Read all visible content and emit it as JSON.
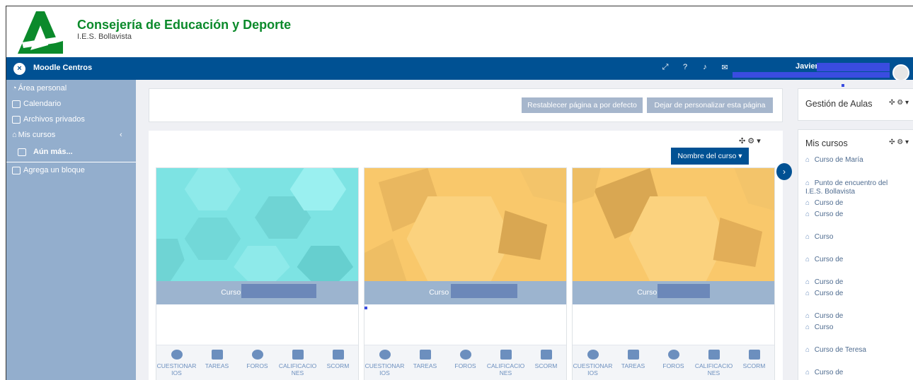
{
  "header": {
    "title": "Consejería de Educación y Deporte",
    "subtitle": "I.E.S. Bollavista"
  },
  "navbar": {
    "site_name": "Moodle Centros",
    "close_icon": "×",
    "user_name": "Javier",
    "icons": [
      "expand-icon",
      "help-icon",
      "bell-icon",
      "mail-icon"
    ]
  },
  "sidebar": {
    "items": [
      {
        "label": "Área personal",
        "icon": "dashboard-icon"
      },
      {
        "label": "Calendario",
        "icon": "calendar-icon"
      },
      {
        "label": "Archivos privados",
        "icon": "files-icon"
      },
      {
        "label": "Mis cursos",
        "icon": "graduation-cap-icon"
      },
      {
        "label": "Aún más...",
        "icon": "folder-icon"
      },
      {
        "label": "Agrega un bloque",
        "icon": "add-block-icon"
      }
    ]
  },
  "main": {
    "reset_button": "Restablecer página a por defecto",
    "stop_customize_button": "Dejar de personalizar esta página",
    "sort_button": "Nombre del curso",
    "courses": [
      {
        "name": "Curso de",
        "color": "#7de3e3"
      },
      {
        "name": "Curso de",
        "color": "#f9c86b"
      },
      {
        "name": "Curso de",
        "color": "#f9c86b"
      }
    ],
    "activities": [
      "CUESTIONAR IOS",
      "TAREAS",
      "FOROS",
      "CALIFICACIO NES",
      "SCORM"
    ]
  },
  "right": {
    "gestion_title": "Gestión de Aulas",
    "mis_cursos_title": "Mis cursos",
    "mis_cursos_items": [
      "Curso de María",
      "Punto de encuentro del",
      "I.E.S. Bollavista",
      "Curso de",
      "Curso de",
      "Curso",
      "Curso de",
      "Curso de",
      "Curso de",
      "Curso de",
      "Curso",
      "Curso de Teresa",
      "Curso de"
    ]
  },
  "colors": {
    "navbar": "#005193",
    "sidebar": "#93aecd",
    "brand_green": "#0b8a2b"
  }
}
